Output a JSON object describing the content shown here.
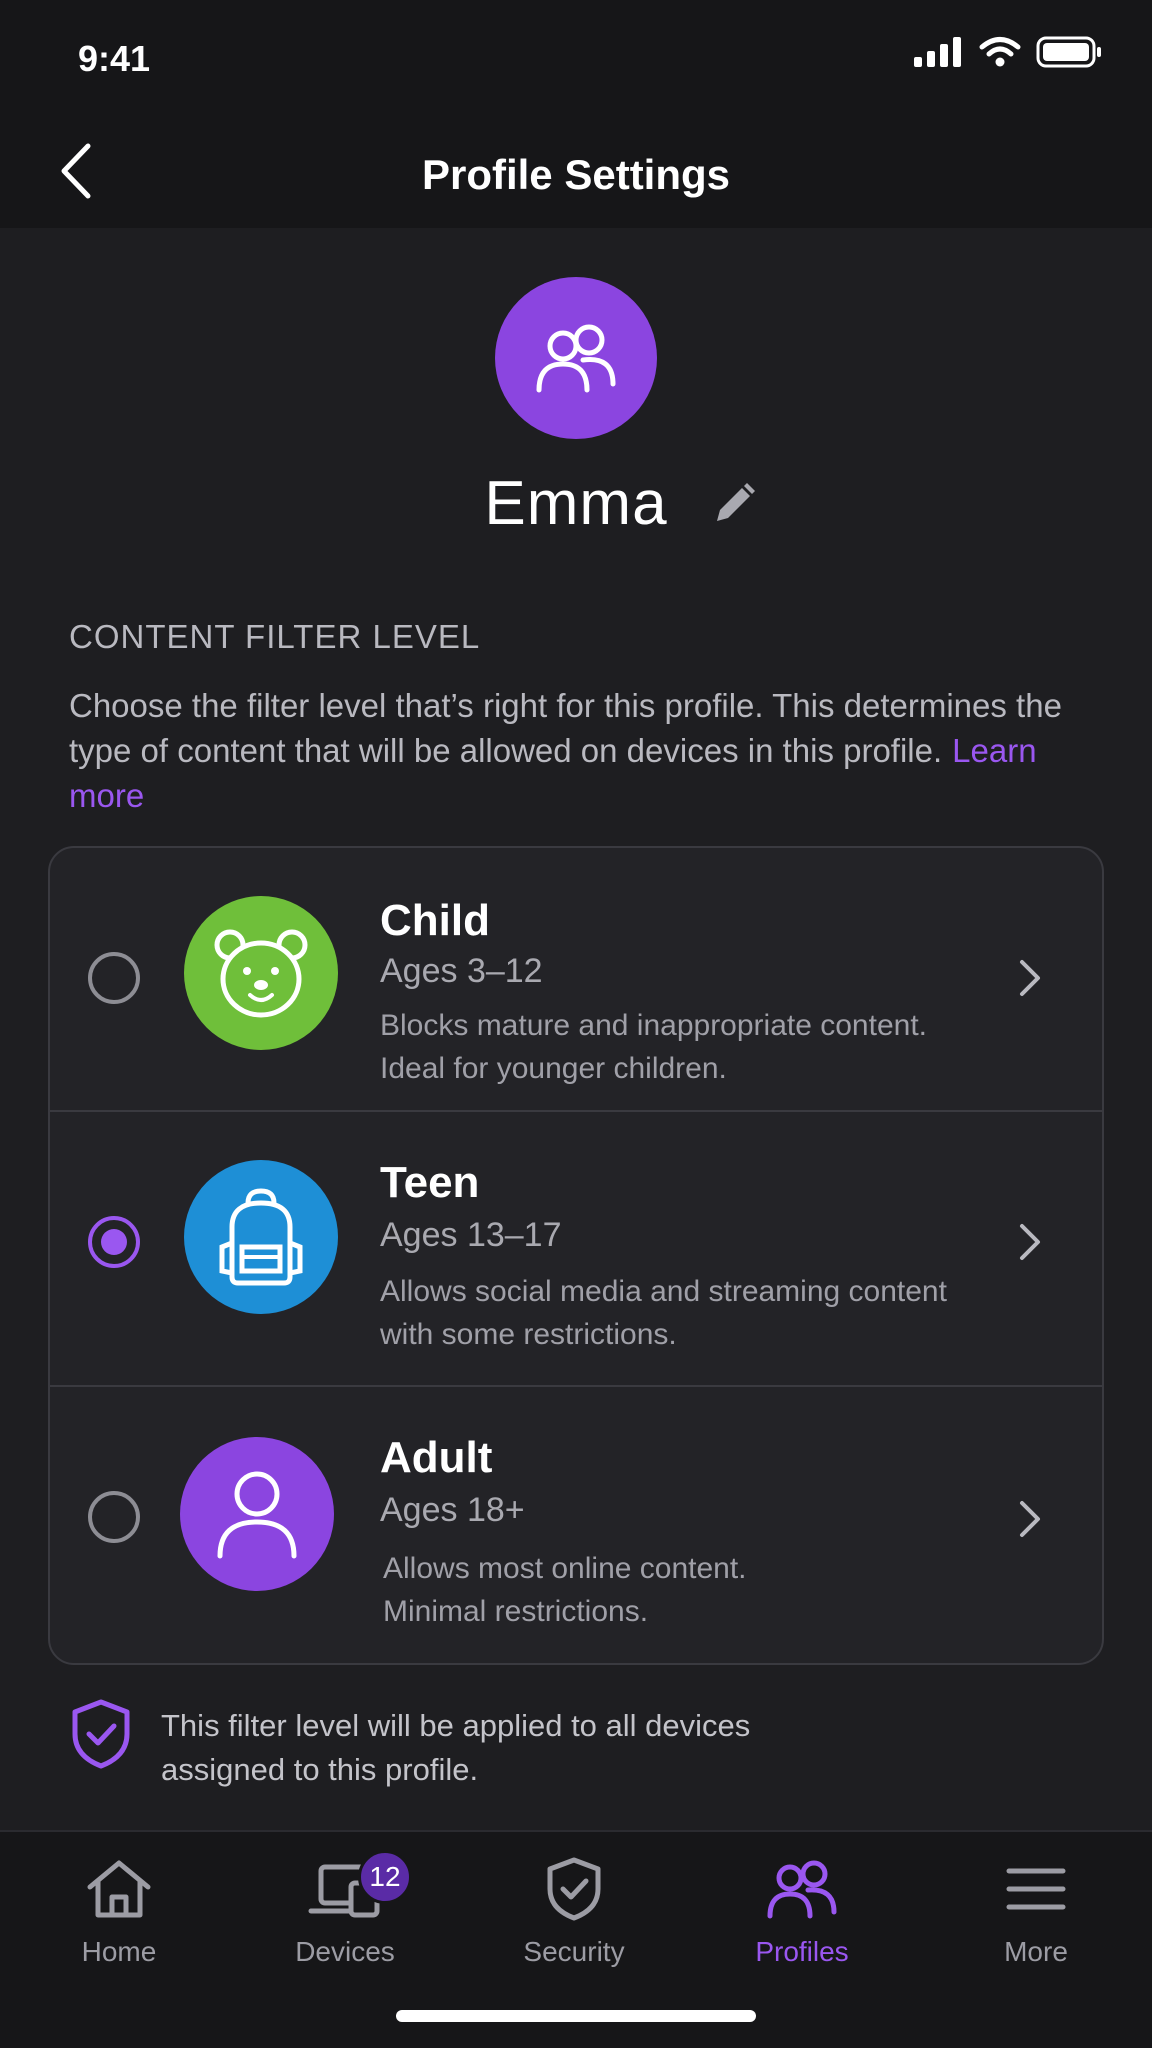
{
  "status_bar": {
    "time": "9:41"
  },
  "header": {
    "title": "Profile Settings"
  },
  "profile": {
    "name": "Emma"
  },
  "filter": {
    "section_title": "CONTENT FILTER LEVEL",
    "description": "Choose the filter level that’s right for this profile. This determines the type of content that will be allowed on devices in this profile.",
    "learn_more": "Learn more",
    "options": [
      {
        "title": "Child",
        "ages": "Ages 3–12",
        "desc_line1": "Blocks mature and inappropriate content.",
        "desc_line2": "Ideal for younger children.",
        "selected": false,
        "icon": "bear-icon",
        "color": "#6fbf3a"
      },
      {
        "title": "Teen",
        "ages": "Ages 13–17",
        "desc_line1": "Allows social media and streaming content",
        "desc_line2": "with some restrictions.",
        "selected": true,
        "icon": "backpack-icon",
        "color": "#1e8fd6"
      },
      {
        "title": "Adult",
        "ages": "Ages 18+",
        "desc_line1": "Allows most online content.",
        "desc_line2": "Minimal restrictions.",
        "selected": false,
        "icon": "person-icon",
        "color": "#8b45e0"
      }
    ],
    "notice": "This filter level will be applied to all devices assigned to this profile."
  },
  "tabs": [
    {
      "label": "Home",
      "icon": "home-icon"
    },
    {
      "label": "Devices",
      "icon": "devices-icon",
      "badge": "12"
    },
    {
      "label": "Security",
      "icon": "shield-check-icon"
    },
    {
      "label": "Profiles",
      "icon": "profiles-icon",
      "active": true
    },
    {
      "label": "More",
      "icon": "menu-icon"
    }
  ],
  "colors": {
    "accent": "#9a57f0",
    "background": "#1e1e21"
  }
}
